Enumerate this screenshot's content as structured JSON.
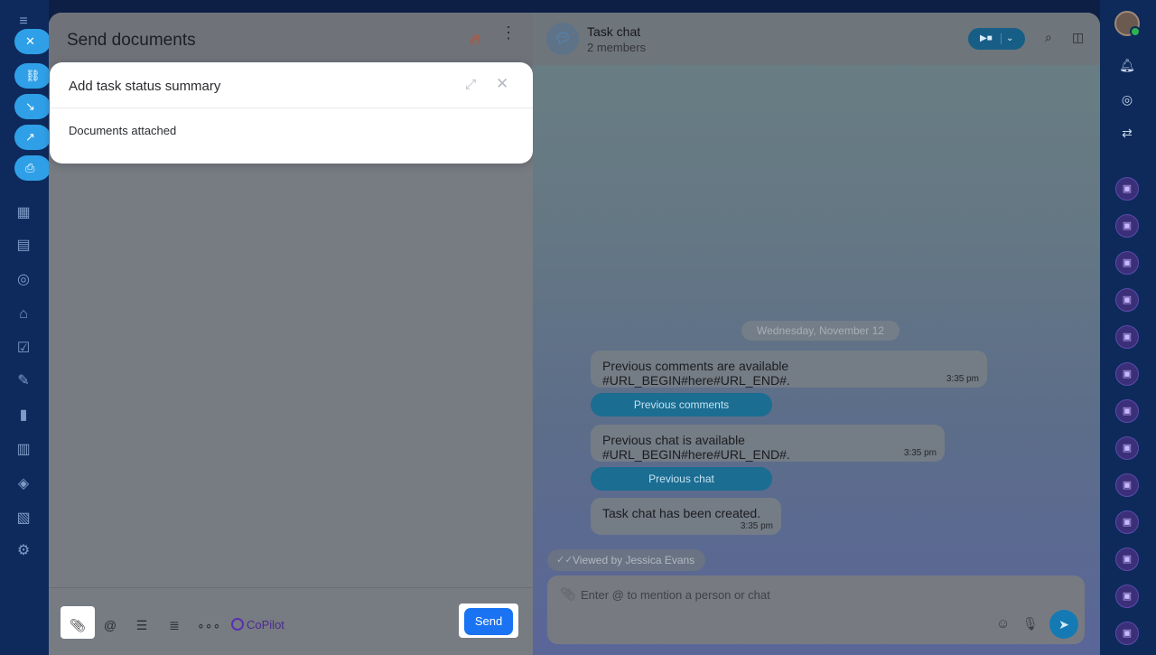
{
  "slider": {
    "title": "Send documents",
    "toolbar": {
      "copilot_label": "CoPilot",
      "send_label": "Send"
    }
  },
  "popup": {
    "title": "Add task status summary",
    "body": "Documents attached"
  },
  "chat": {
    "title": "Task chat",
    "subtitle": "2 members",
    "date_separator": "Wednesday, November 12",
    "messages": [
      {
        "text": "Previous comments are available #URL_BEGIN#here#URL_END#.",
        "time": "3:35 pm"
      },
      {
        "text": "Previous chat is available #URL_BEGIN#here#URL_END#.",
        "time": "3:35 pm"
      },
      {
        "text": "Task chat has been created.",
        "time": "3:35 pm"
      }
    ],
    "buttons": [
      "Previous comments",
      "Previous chat"
    ],
    "viewed_by": "Viewed by Jessica Evans",
    "composer_placeholder": "Enter @ to mention a person or chat"
  },
  "colors": {
    "send_button": "#1a73f3",
    "accent": "#2fa0e8",
    "copilot": "#5b2fb0"
  }
}
